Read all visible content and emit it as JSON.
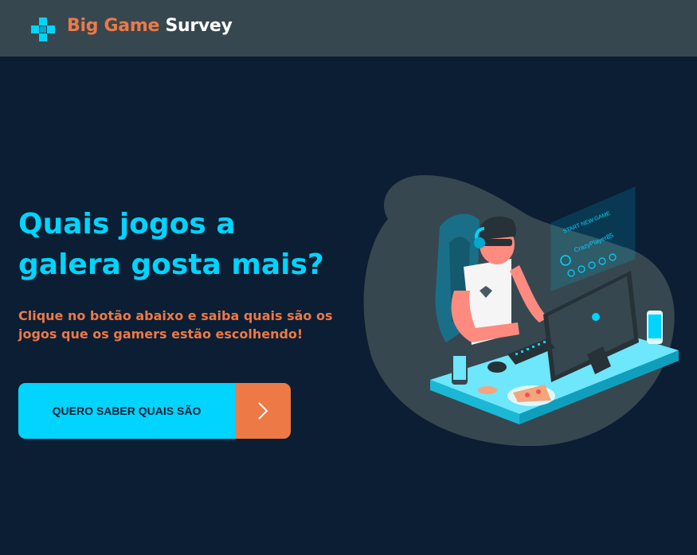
{
  "header": {
    "brand_part1": "Big Game",
    "brand_part2": "Survey",
    "logo_icon": "gamepad-cross-icon"
  },
  "main": {
    "headline_line1": "Quais jogos a",
    "headline_line2": "galera gosta mais?",
    "subtext_line1": "Clique no botão abaixo e saiba quais são os",
    "subtext_line2": "jogos que os gamers estão escolhendo!",
    "cta_label": "QUERO SABER QUAIS SÃO",
    "cta_icon": "chevron-right-icon"
  },
  "illustration": {
    "screen_title": "START NEW GAME",
    "player_name": "CrazyPlayer85"
  },
  "colors": {
    "background": "#0b1e33",
    "header": "#37474f",
    "primary": "#00d4ff",
    "accent": "#ed7947"
  }
}
